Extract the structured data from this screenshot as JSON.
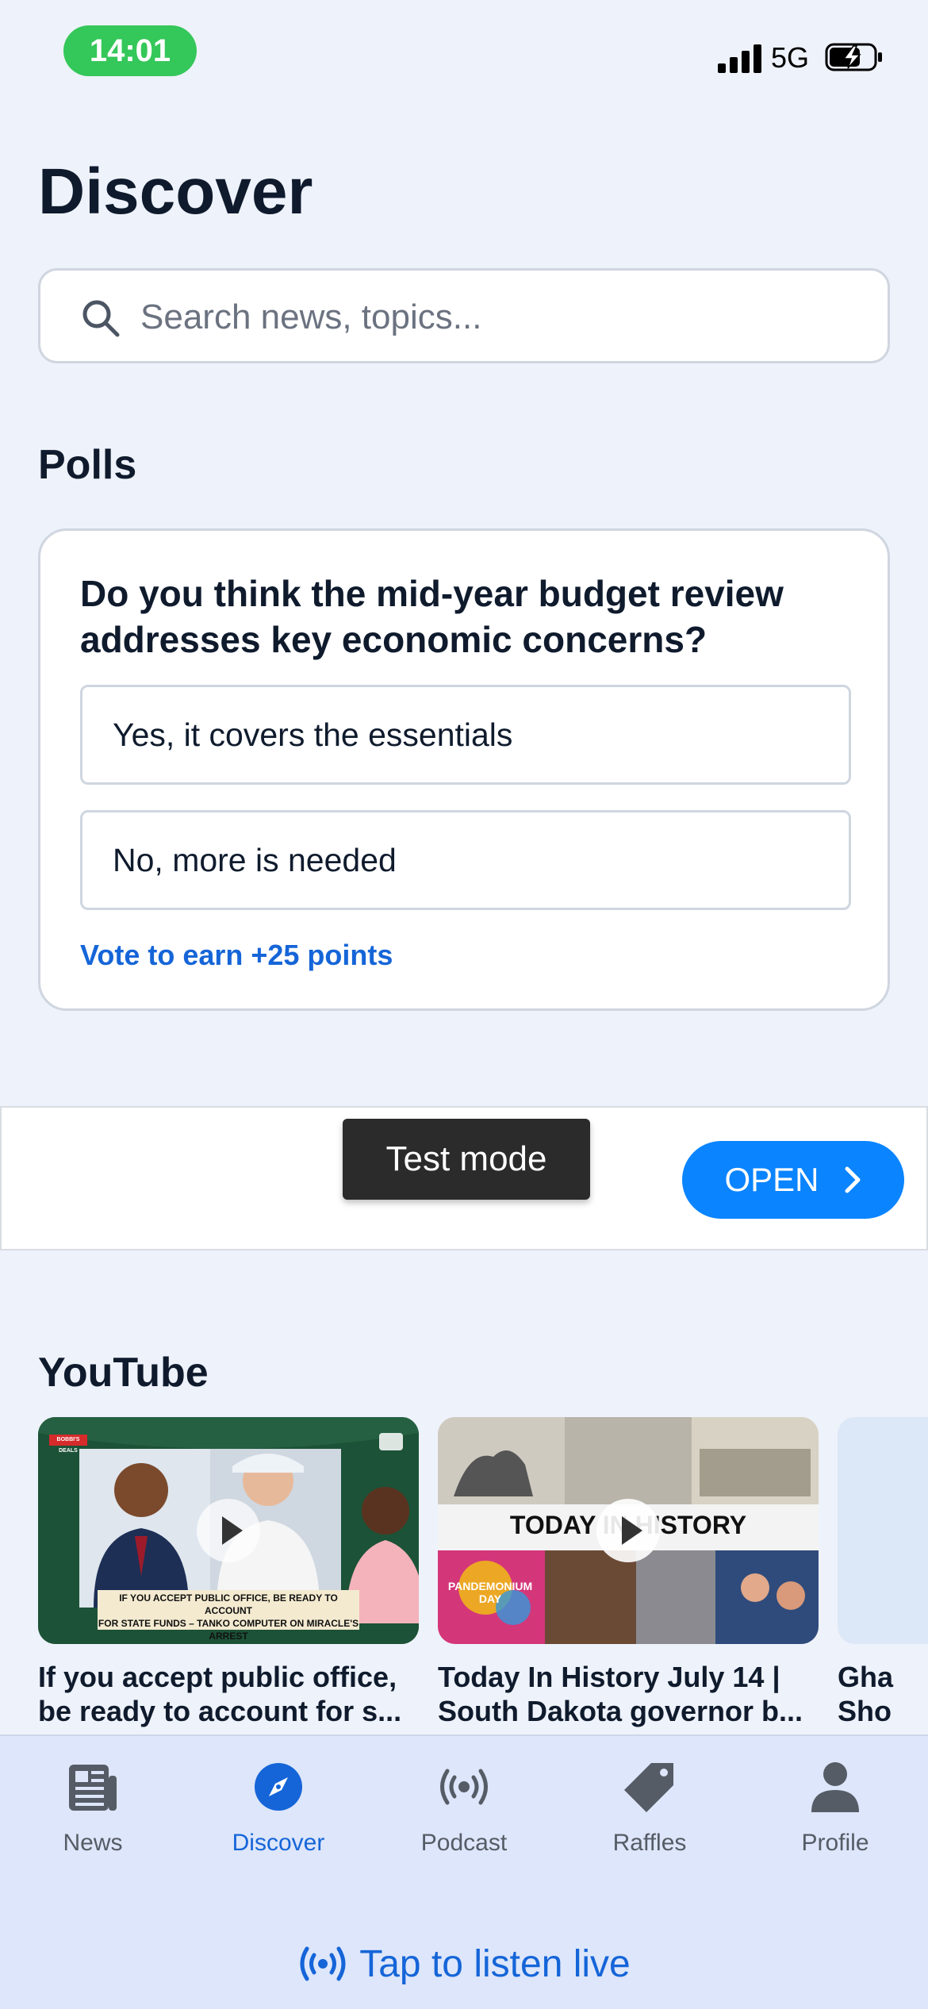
{
  "status_bar": {
    "time": "14:01",
    "network": "5G"
  },
  "page": {
    "title": "Discover"
  },
  "search": {
    "placeholder": "Search news, topics..."
  },
  "polls": {
    "section_title": "Polls",
    "question": "Do you think the mid-year budget review addresses key economic concerns?",
    "options": [
      {
        "label": "Yes, it covers the essentials"
      },
      {
        "label": "No, more is needed"
      }
    ],
    "reward_text": "Vote to earn +25 points"
  },
  "ad": {
    "badge": "Test mode",
    "cta": "OPEN"
  },
  "youtube": {
    "section_title": "YouTube",
    "videos": [
      {
        "title_line1": "If you accept public office,",
        "title_line2": "be ready to account for s...",
        "thumb_caption_line1": "IF YOU ACCEPT PUBLIC OFFICE, BE READY TO ACCOUNT",
        "thumb_caption_line2": "FOR STATE FUNDS – TANKO COMPUTER ON MIRACLE'S ARREST",
        "thumb_tag": "BOBBI'S DEALS"
      },
      {
        "title_line1": "Today In History July 14 |",
        "title_line2": "South Dakota governor b...",
        "thumb_heading": "TODAY IN HISTORY",
        "thumb_label": "PANDEMONIUM DAY"
      },
      {
        "title_line1": "Gha",
        "title_line2": "Sho"
      }
    ]
  },
  "tabs": [
    {
      "label": "News",
      "icon": "newspaper-icon"
    },
    {
      "label": "Discover",
      "icon": "compass-icon",
      "active": true
    },
    {
      "label": "Podcast",
      "icon": "broadcast-icon"
    },
    {
      "label": "Raffles",
      "icon": "tag-icon"
    },
    {
      "label": "Profile",
      "icon": "person-icon"
    }
  ],
  "live": {
    "label": "Tap to listen live"
  },
  "colors": {
    "accent": "#1565d8",
    "ad_button": "#0a84ff",
    "time_pill": "#34c759"
  }
}
